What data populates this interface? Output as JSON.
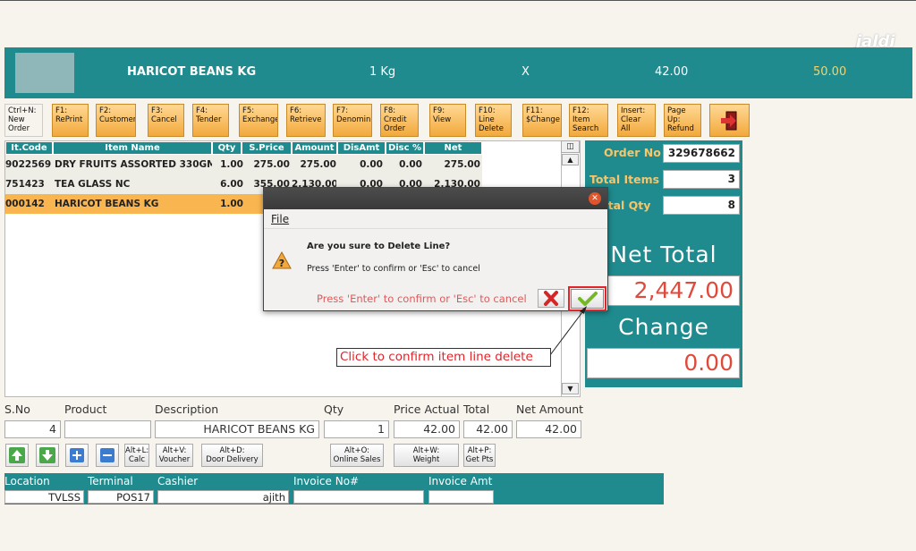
{
  "banner": {
    "item": "HARICOT  BEANS KG",
    "unit": "1 Kg",
    "mult": "X",
    "price": "42.00",
    "amount": "50.00"
  },
  "watermark": "jaldi",
  "fkeys": [
    {
      "label": "Ctrl+N:\nNew\nOrder"
    },
    {
      "label": "F1:\nRePrint"
    },
    {
      "label": "F2:\nCustomer"
    },
    {
      "label": "F3:\nCancel"
    },
    {
      "label": "F4:\nTender"
    },
    {
      "label": "F5:\nExchange"
    },
    {
      "label": "F6:\nRetrieve"
    },
    {
      "label": "F7:\nDenomin"
    },
    {
      "label": "F8:\nCredit\nOrder"
    },
    {
      "label": "F9:\nView"
    },
    {
      "label": "F10:\nLine\nDelete"
    },
    {
      "label": "F11:\n$Change"
    },
    {
      "label": "F12:\nItem\nSearch"
    },
    {
      "label": "Insert:\nClear All"
    },
    {
      "label": "Page Up:\nRefund"
    }
  ],
  "grid": {
    "headers": [
      "It.Code",
      "Item Name",
      "Qty",
      "S.Price",
      "Amount",
      "DisAmt",
      "Disc %",
      "Net Amount"
    ],
    "rows": [
      [
        "9022569",
        "DRY FRUITS ASSORTED 330GM",
        "1.00",
        "275.00",
        "275.00",
        "0.00",
        "0.00",
        "275.00"
      ],
      [
        "751423",
        "TEA GLASS NC",
        "6.00",
        "355.00",
        "2,130.00",
        "0.00",
        "0.00",
        "2,130.00"
      ],
      [
        "000142",
        "HARICOT  BEANS KG",
        "1.00",
        "",
        "",
        "",
        "",
        ""
      ]
    ]
  },
  "summary": {
    "order_no_label": "Order No",
    "order_no": "329678662",
    "total_items_label": "Total Items",
    "total_items": "3",
    "total_qty_label": "otal Qty",
    "total_qty": "8",
    "net_total_label": "Net Total",
    "net_total": "2,447.00",
    "change_label": "Change",
    "change": "0.00"
  },
  "form": {
    "sno_label": "S.No",
    "sno": "4",
    "product_label": "Product",
    "product": "",
    "desc_label": "Description",
    "desc": "HARICOT  BEANS KG",
    "qty_label": "Qty",
    "qty": "1",
    "price_label": "Price Actual",
    "price": "42.00",
    "total_label": "Total",
    "total": "42.00",
    "net_label": "Net Amount",
    "net": "42.00"
  },
  "tools": {
    "calc": "Alt+L:\nCalc",
    "voucher": "Alt+V:\nVoucher",
    "door": "Alt+D:\nDoor Delivery",
    "online": "Alt+O:\nOnline Sales",
    "weight": "Alt+W:\nWeight",
    "getpts": "Alt+P:\nGet Pts"
  },
  "footer": {
    "location_label": "Location",
    "location": "TVLSS",
    "terminal_label": "Terminal",
    "terminal": "POS17",
    "cashier_label": "Cashier",
    "cashier": "ajith",
    "invoice_label": "Invoice No#",
    "invoice": "",
    "invamt_label": "Invoice Amt",
    "invamt": ""
  },
  "dialog": {
    "menu_file": "File",
    "question": "Are you sure to Delete Line?",
    "hint": "Press 'Enter' to confirm or 'Esc' to cancel",
    "hint_red": "Press 'Enter' to confirm or 'Esc' to cancel"
  },
  "callout": "Click to confirm item line delete",
  "colors": {
    "teal": "#1f8b8e",
    "orange": "#f9b650",
    "selected_row": "#f9b650",
    "accent_red": "#e04a3a"
  }
}
